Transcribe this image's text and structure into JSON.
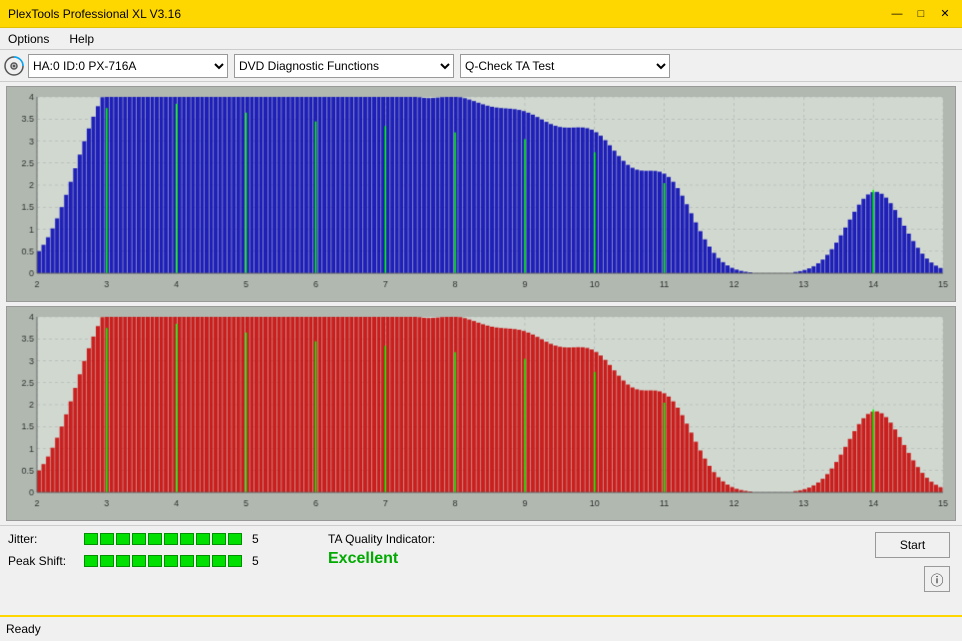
{
  "titleBar": {
    "title": "PlexTools Professional XL V3.16",
    "minimizeLabel": "—",
    "maximizeLabel": "□",
    "closeLabel": "✕"
  },
  "menuBar": {
    "items": [
      {
        "label": "Options"
      },
      {
        "label": "Help"
      }
    ]
  },
  "toolbar": {
    "deviceIcon": "disc-icon",
    "deviceValue": "HA:0 ID:0  PX-716A",
    "functionValue": "DVD Diagnostic Functions",
    "testValue": "Q-Check TA Test"
  },
  "charts": {
    "topChart": {
      "color": "#0000cc",
      "yMax": 4,
      "xMin": 2,
      "xMax": 15
    },
    "bottomChart": {
      "color": "#cc0000",
      "yMax": 4,
      "xMin": 2,
      "xMax": 15
    }
  },
  "metrics": {
    "jitter": {
      "label": "Jitter:",
      "segments": 10,
      "value": "5"
    },
    "peakShift": {
      "label": "Peak Shift:",
      "segments": 10,
      "value": "5"
    },
    "taQuality": {
      "label": "TA Quality Indicator:",
      "value": "Excellent"
    }
  },
  "buttons": {
    "start": "Start",
    "info": "ⓘ"
  },
  "statusBar": {
    "status": "Ready"
  }
}
